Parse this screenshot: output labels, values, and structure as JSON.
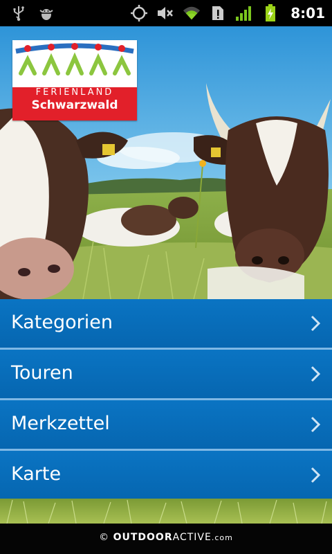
{
  "status_bar": {
    "time": "8:01",
    "icons": [
      "usb-icon",
      "android-debug-icon",
      "gps-icon",
      "mute-icon",
      "wifi-icon",
      "sim-alert-icon",
      "signal-icon",
      "battery-charging-icon"
    ]
  },
  "logo": {
    "line1": "FERIENLAND",
    "line2": "Schwarzwald"
  },
  "menu": {
    "items": [
      {
        "label": "Kategorien"
      },
      {
        "label": "Touren"
      },
      {
        "label": "Merkzettel"
      },
      {
        "label": "Karte"
      }
    ]
  },
  "footer": {
    "copyright": "©",
    "brand_bold": "OUTDOOR",
    "brand_light": "ACTIVE",
    "brand_suffix": ".com"
  },
  "colors": {
    "menu_blue": "#0a74c3",
    "logo_red": "#e2202a",
    "status_bar": "#000000",
    "battery_green": "#9bd318"
  }
}
